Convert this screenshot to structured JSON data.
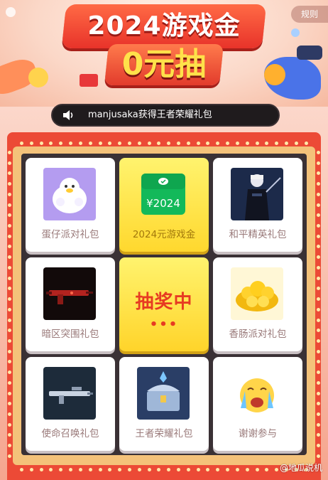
{
  "header": {
    "year_title": "2024游戏金",
    "main_title": "0元抽",
    "rules_label": "规则"
  },
  "ticker": {
    "text": "manjusaka获得王者荣耀礼包"
  },
  "prizes": [
    {
      "label": "蛋仔派对礼包",
      "icon": "eggy-party-mascot-icon",
      "active": false
    },
    {
      "label": "2024元游戏金",
      "icon": "wechat-pay-card-icon",
      "active": true,
      "card_amount": "¥2024"
    },
    {
      "label": "和平精英礼包",
      "icon": "peace-elite-character-icon",
      "active": false
    },
    {
      "label": "暗区突围礼包",
      "icon": "arena-breakout-rifle-icon",
      "active": false
    },
    {
      "label": "香肠派对礼包",
      "icon": "sausage-party-gold-icon",
      "active": false
    },
    {
      "label": "使命召唤礼包",
      "icon": "call-of-duty-weapon-icon",
      "active": false
    },
    {
      "label": "王者荣耀礼包",
      "icon": "honor-of-kings-chest-icon",
      "active": false
    },
    {
      "label": "谢谢参与",
      "icon": "crying-face-icon",
      "active": false
    }
  ],
  "draw_button": {
    "label": "抽奖中",
    "dots": "•••"
  },
  "watermark": {
    "text": "@地瓜说机"
  },
  "colors": {
    "frame_red": "#ec4a36",
    "active_yellow": "#ffd82e",
    "title_yellow": "#ffe14a",
    "draw_text_red": "#e73b22"
  }
}
